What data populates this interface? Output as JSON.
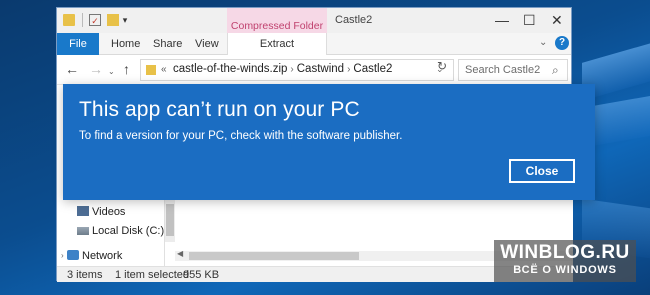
{
  "window": {
    "title": "Castle2",
    "context_tab_group": "Compressed Folder Tools",
    "controls": {
      "minimize": "—",
      "maximize": "☐",
      "close": "✕"
    },
    "quick_access": {
      "dropdown": "▾"
    }
  },
  "ribbon": {
    "tabs": [
      "File",
      "Home",
      "Share",
      "View",
      "Extract"
    ],
    "expand_glyph": "⌄",
    "help_glyph": "?"
  },
  "navigation": {
    "back": "←",
    "forward": "→",
    "recent": "⌄",
    "up": "↑"
  },
  "address": {
    "overflow": "«",
    "path": [
      "castle-of-the-winds.zip",
      "Castwind",
      "Castle2"
    ],
    "separator": "›",
    "dropdown": "⌄",
    "refresh": "↻"
  },
  "search": {
    "placeholder": "Search Castle2",
    "icon": "search-icon"
  },
  "nav_pane": {
    "items": [
      {
        "label": "Videos",
        "icon": "videos-folder-icon"
      },
      {
        "label": "Local Disk (C:)",
        "icon": "drive-icon"
      },
      {
        "label": "Network",
        "icon": "network-icon"
      }
    ],
    "expand_glyph": "›"
  },
  "status_bar": {
    "items_count": "3 items",
    "selected": "1 item selected",
    "size": "955 KB"
  },
  "dialog": {
    "title": "This app can’t run on your PC",
    "message": "To find a version for your PC, check with the software publisher.",
    "close_label": "Close",
    "color": "#1b6dc2"
  },
  "watermark": {
    "main": "WINBLOG.RU",
    "sub": "ВСЁ О WINDOWS"
  }
}
